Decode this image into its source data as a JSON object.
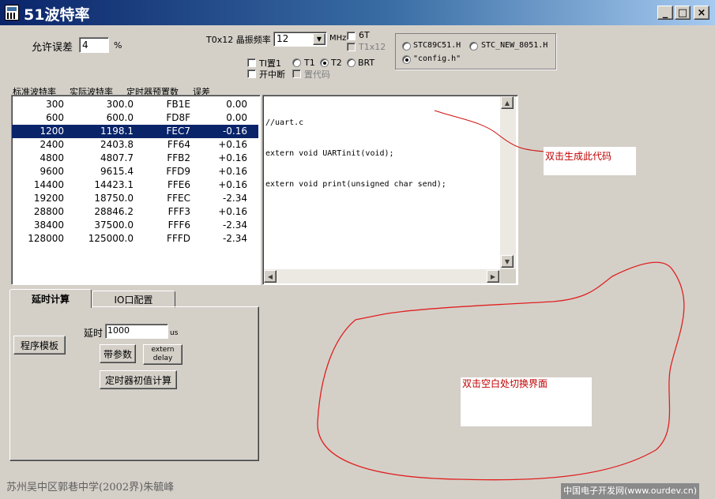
{
  "window": {
    "title": "51波特率",
    "minimize": "_",
    "maximize": "□",
    "close": "×"
  },
  "error_tolerance": {
    "label": "允许误差",
    "value": "4",
    "unit": "%"
  },
  "crystal": {
    "label": "T0x12 晶振频率",
    "value": "12",
    "unit": "MHz"
  },
  "options": {
    "six_t": "6T",
    "t1x12": "T1x12",
    "ti_label": "TI置1",
    "t1": "T1",
    "t2": "T2",
    "brt": "BRT",
    "enable_int": "开中断",
    "set_code": "置代码"
  },
  "header_radios": {
    "stc89c51": "STC89C51.H",
    "stc_new_8051": "STC_NEW_8051.H",
    "config_h": "\"config.h\""
  },
  "table": {
    "headers": [
      "标准波特率",
      "实际波特率",
      "定时器预置数",
      "误差"
    ],
    "rows": [
      [
        "300",
        "300.0",
        "FB1E",
        "0.00"
      ],
      [
        "600",
        "600.0",
        "FD8F",
        "0.00"
      ],
      [
        "1200",
        "1198.1",
        "FEC7",
        "-0.16"
      ],
      [
        "2400",
        "2403.8",
        "FF64",
        "+0.16"
      ],
      [
        "4800",
        "4807.7",
        "FFB2",
        "+0.16"
      ],
      [
        "9600",
        "9615.4",
        "FFD9",
        "+0.16"
      ],
      [
        "14400",
        "14423.1",
        "FFE6",
        "+0.16"
      ],
      [
        "19200",
        "18750.0",
        "FFEC",
        "-2.34"
      ],
      [
        "28800",
        "28846.2",
        "FFF3",
        "+0.16"
      ],
      [
        "38400",
        "37500.0",
        "FFF6",
        "-2.34"
      ],
      [
        "128000",
        "125000.0",
        "FFFD",
        "-2.34"
      ]
    ]
  },
  "code": {
    "lines": [
      "//uart.c",
      "extern void UARTinit(void);",
      "extern void print(unsigned char send);"
    ]
  },
  "tabs": [
    "延时计算",
    "IO口配置"
  ],
  "delay": {
    "template_button": "程序模板",
    "delay_label": "延时",
    "delay_value": "1000",
    "delay_unit": "us",
    "with_params_button": "带参数",
    "extern_delay_line1": "extern",
    "extern_delay_line2": "delay",
    "timer_init_button": "定时器初值计算"
  },
  "annotations": {
    "generate_code": "双击生成此代码",
    "switch_ui": "双击空白处切换界面"
  },
  "footer": {
    "author": "苏州吴中区郭巷中学(2002界)朱毓峰",
    "watermark": "中国电子开发网(www.ourdev.cn)"
  }
}
